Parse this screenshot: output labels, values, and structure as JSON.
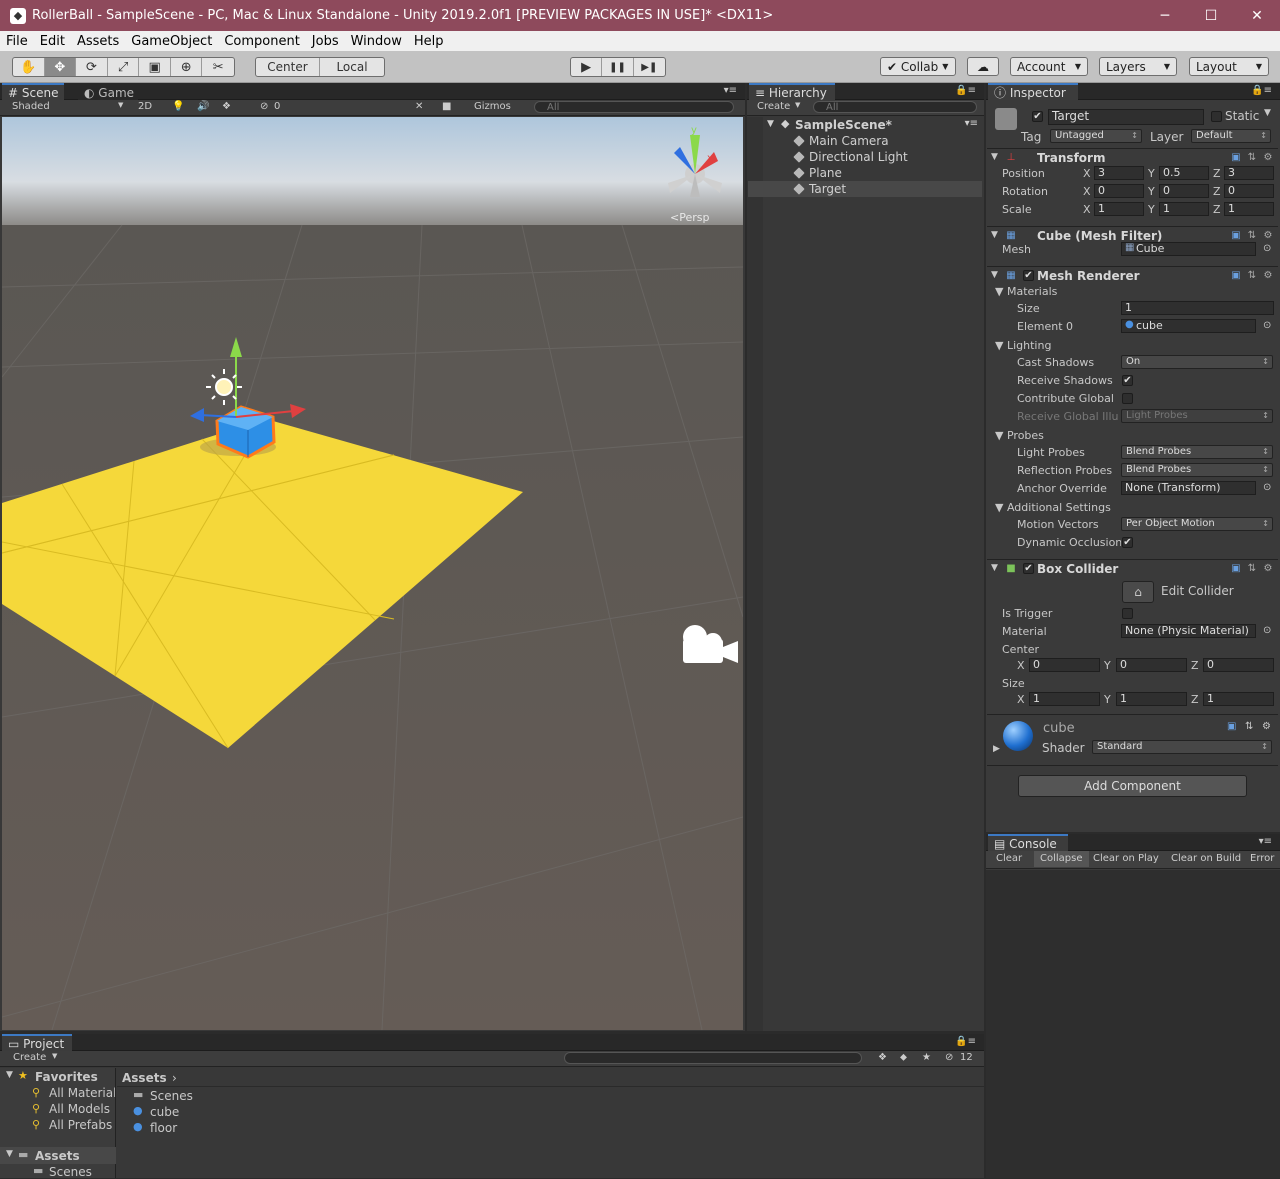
{
  "window": {
    "title": "RollerBall - SampleScene - PC, Mac & Linux Standalone - Unity 2019.2.0f1 [PREVIEW PACKAGES IN USE]* <DX11>",
    "minimize": "─",
    "maximize": "☐",
    "close": "✕"
  },
  "menu": [
    "File",
    "Edit",
    "Assets",
    "GameObject",
    "Component",
    "Jobs",
    "Window",
    "Help"
  ],
  "toolbar": {
    "center": "Center",
    "local": "Local",
    "collab": "Collab",
    "account": "Account",
    "layers": "Layers",
    "layout": "Layout",
    "play": "▶",
    "pause": "❚❚",
    "step": "▶❚"
  },
  "scene_tabs": {
    "scene": "Scene",
    "game": "Game"
  },
  "scene_bar": {
    "shading": "Shaded",
    "mode2d": "2D",
    "hidden_count": "0",
    "gizmos": "Gizmos",
    "search_placeholder": "All"
  },
  "scene_view": {
    "projection": "Persp",
    "axis_x": "x",
    "axis_y": "y"
  },
  "hierarchy": {
    "tab": "Hierarchy",
    "create": "Create",
    "search_placeholder": "All",
    "scene": "SampleScene*",
    "items": [
      "Main Camera",
      "Directional Light",
      "Plane",
      "Target"
    ],
    "selected": "Target"
  },
  "inspector": {
    "tab": "Inspector",
    "object_name": "Target",
    "static_label": "Static",
    "tag_label": "Tag",
    "tag_value": "Untagged",
    "layer_label": "Layer",
    "layer_value": "Default",
    "transform": {
      "title": "Transform",
      "position_label": "Position",
      "rotation_label": "Rotation",
      "scale_label": "Scale",
      "position": {
        "x": "3",
        "y": "0.5",
        "z": "3"
      },
      "rotation": {
        "x": "0",
        "y": "0",
        "z": "0"
      },
      "scale": {
        "x": "1",
        "y": "1",
        "z": "1"
      },
      "x": "X",
      "y": "Y",
      "z": "Z"
    },
    "mesh_filter": {
      "title": "Cube (Mesh Filter)",
      "mesh_label": "Mesh",
      "mesh_value": "Cube"
    },
    "mesh_renderer": {
      "title": "Mesh Renderer",
      "materials": "Materials",
      "size_label": "Size",
      "size_value": "1",
      "element0_label": "Element 0",
      "element0_value": "cube",
      "lighting": "Lighting",
      "cast_shadows_label": "Cast Shadows",
      "cast_shadows_value": "On",
      "receive_shadows_label": "Receive Shadows",
      "contribute_global_label": "Contribute Global",
      "receive_global_label": "Receive Global Illu",
      "receive_global_value": "Light Probes",
      "probes": "Probes",
      "light_probes_label": "Light Probes",
      "light_probes_value": "Blend Probes",
      "reflection_probes_label": "Reflection Probes",
      "reflection_probes_value": "Blend Probes",
      "anchor_override_label": "Anchor Override",
      "anchor_override_value": "None (Transform)",
      "additional": "Additional Settings",
      "motion_vectors_label": "Motion Vectors",
      "motion_vectors_value": "Per Object Motion",
      "dynamic_occlusion_label": "Dynamic Occlusion"
    },
    "box_collider": {
      "title": "Box Collider",
      "edit_collider": "Edit Collider",
      "is_trigger_label": "Is Trigger",
      "material_label": "Material",
      "material_value": "None (Physic Material)",
      "center_label": "Center",
      "center": {
        "x": "0",
        "y": "0",
        "z": "0"
      },
      "size_label": "Size",
      "size": {
        "x": "1",
        "y": "1",
        "z": "1"
      }
    },
    "material": {
      "name": "cube",
      "shader_label": "Shader",
      "shader_value": "Standard"
    },
    "add_component": "Add Component"
  },
  "console": {
    "tab": "Console",
    "buttons": [
      "Clear",
      "Collapse",
      "Clear on Play",
      "Clear on Build",
      "Error"
    ]
  },
  "project": {
    "tab": "Project",
    "create": "Create",
    "count": "12",
    "favorites": "Favorites",
    "favorite_items": [
      "All Materials",
      "All Models",
      "All Prefabs"
    ],
    "assets": "Assets",
    "assets_children": [
      "Scenes"
    ],
    "breadcrumb": "Assets",
    "files": [
      {
        "name": "Scenes",
        "kind": "folder"
      },
      {
        "name": "cube",
        "kind": "material"
      },
      {
        "name": "floor",
        "kind": "material"
      }
    ]
  },
  "colors": {
    "title_bar": "#8e4a5c",
    "tab_accent": "#3c79c4",
    "plane": "#f5d83a",
    "selection": "#ff7a1a",
    "cube": "#2d8fe6",
    "sky": "#c7d6e4",
    "ground": "#5d5850"
  }
}
